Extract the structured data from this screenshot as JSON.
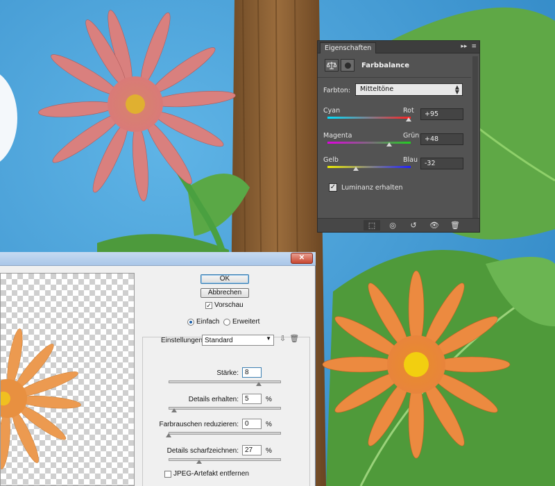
{
  "properties_panel": {
    "tab_label": "Eigenschaften",
    "title": "Farbbalance",
    "tone_label": "Farbton:",
    "tone_value": "Mitteltöne",
    "sliders": [
      {
        "left": "Cyan",
        "right": "Rot",
        "value": 95,
        "display": "+95",
        "left_color": "#00e0ff",
        "right_color": "#ff2020"
      },
      {
        "left": "Magenta",
        "right": "Grün",
        "value": 48,
        "display": "+48",
        "left_color": "#e000e0",
        "right_color": "#20d020"
      },
      {
        "left": "Gelb",
        "right": "Blau",
        "value": -32,
        "display": "-32",
        "left_color": "#f0f000",
        "right_color": "#2020ff"
      }
    ],
    "luminance_label": "Luminanz erhalten",
    "luminance_checked": true,
    "footer_icons": [
      "clip-to-layer-icon",
      "view-previous-state-icon",
      "reset-icon",
      "visibility-eye-icon",
      "trash-icon"
    ]
  },
  "dialog": {
    "ok_label": "OK",
    "cancel_label": "Abbrechen",
    "preview_label": "Vorschau",
    "preview_checked": true,
    "mode_simple": "Einfach",
    "mode_advanced": "Erweitert",
    "mode_selected": "Einfach",
    "settings_label": "Einstellungen:",
    "settings_value": "Standard",
    "params": [
      {
        "label": "Stärke:",
        "value": "8",
        "unit": "",
        "max": 10
      },
      {
        "label": "Details erhalten:",
        "value": "5",
        "unit": "%",
        "max": 100
      },
      {
        "label": "Farbrauschen reduzieren:",
        "value": "0",
        "unit": "%",
        "max": 100
      },
      {
        "label": "Details scharfzeichnen:",
        "value": "27",
        "unit": "%",
        "max": 100
      }
    ],
    "jpeg_label": "JPEG-Artefakt entfernen",
    "jpeg_checked": false,
    "close_glyph": "✕"
  }
}
